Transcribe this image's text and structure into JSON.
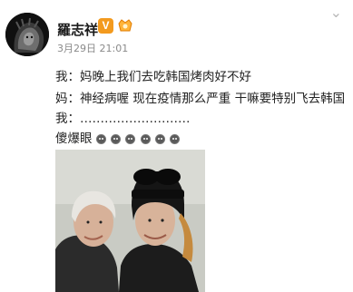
{
  "post": {
    "username": "羅志祥",
    "verified_badge": "V",
    "timestamp": "3月29日 21:01",
    "lines": {
      "line1": "我：妈晚上我们去吃韩国烤肉好不好",
      "line2": "妈：神经病喔 现在疫情那么严重 干嘛要特别飞去韩国",
      "line3": "我：………………………",
      "line4": "傻爆眼"
    },
    "emoji_count": 6,
    "colors": {
      "verified": "#f39a1e",
      "meta_text": "#8a8a8a"
    }
  }
}
